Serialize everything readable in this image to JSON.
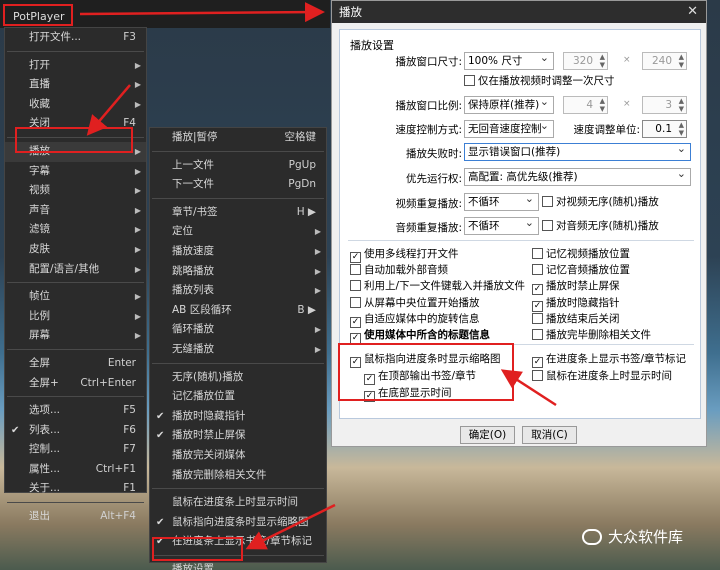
{
  "app": {
    "name": "PotPlayer"
  },
  "main_menu": [
    {
      "label": "打开文件...",
      "shortcut": "F3"
    },
    {
      "label": "打开",
      "arrow": "▶"
    },
    {
      "label": "直播",
      "arrow": "▶"
    },
    {
      "label": "收藏",
      "arrow": "▶"
    },
    {
      "label": "关闭",
      "shortcut": "F4"
    },
    {
      "label": "播放",
      "arrow": "▶"
    },
    {
      "label": "字幕",
      "arrow": "▶"
    },
    {
      "label": "视频",
      "arrow": "▶"
    },
    {
      "label": "声音",
      "arrow": "▶"
    },
    {
      "label": "滤镜",
      "arrow": "▶"
    },
    {
      "label": "皮肤",
      "arrow": "▶"
    },
    {
      "label": "配置/语言/其他",
      "arrow": "▶"
    },
    {
      "label": "帧位",
      "arrow": "▶"
    },
    {
      "label": "比例",
      "arrow": "▶"
    },
    {
      "label": "屏幕",
      "arrow": "▶"
    },
    {
      "label": "全屏",
      "shortcut": "Enter"
    },
    {
      "label": "全屏+",
      "shortcut": "Ctrl+Enter"
    },
    {
      "label": "选项...",
      "shortcut": "F5"
    },
    {
      "label": "列表...",
      "shortcut": "F6",
      "check": "✔"
    },
    {
      "label": "控制...",
      "shortcut": "F7"
    },
    {
      "label": "属性...",
      "shortcut": "Ctrl+F1"
    },
    {
      "label": "关于...",
      "shortcut": "F1"
    },
    {
      "label": "退出",
      "shortcut": "Alt+F4"
    }
  ],
  "play_menu": [
    {
      "label": "播放|暂停",
      "shortcut": "空格键"
    },
    {
      "label": "上一文件",
      "shortcut": "PgUp"
    },
    {
      "label": "下一文件",
      "shortcut": "PgDn"
    },
    {
      "label": "章节/书签",
      "shortcut": "H ▶"
    },
    {
      "label": "定位",
      "arrow": "▶"
    },
    {
      "label": "播放速度",
      "arrow": "▶"
    },
    {
      "label": "跳略播放",
      "arrow": "▶"
    },
    {
      "label": "播放列表",
      "arrow": "▶"
    },
    {
      "label": "AB 区段循环",
      "shortcut": "B ▶"
    },
    {
      "label": "循环播放",
      "arrow": "▶"
    },
    {
      "label": "无缝播放",
      "arrow": "▶"
    },
    {
      "label": "无序(随机)播放"
    },
    {
      "label": "记忆播放位置"
    },
    {
      "label": "播放时隐藏指针",
      "check": "✔"
    },
    {
      "label": "播放时禁止屏保",
      "check": "✔"
    },
    {
      "label": "播放完关闭媒体"
    },
    {
      "label": "播放完删除相关文件"
    },
    {
      "label": "鼠标在进度条上时显示时间"
    },
    {
      "label": "鼠标指向进度条时显示缩略图",
      "check": "✔"
    },
    {
      "label": "在进度条上显示书签/章节标记",
      "check": "✔"
    },
    {
      "label": "播放设置..."
    }
  ],
  "dialog": {
    "title": "播放",
    "close": "✕",
    "group": "播放设置",
    "window_size_label": "播放窗口尺寸:",
    "window_size": "100% 尺寸",
    "width": "320",
    "height": "240",
    "times": "×",
    "only_first_resize": "仅在播放视频时调整一次尺寸",
    "aspect_label": "播放窗口比例:",
    "aspect": "保持原样(推荐)",
    "ratio_w": "4",
    "ratio_h": "3",
    "speed_ctrl_label": "速度控制方式:",
    "speed_ctrl": "无回音速度控制",
    "speed_unit_label": "速度调整单位:",
    "speed_unit": "0.1",
    "fail_label": "播放失败时:",
    "fail": "显示错误窗口(推荐)",
    "priority_label": "优先运行权:",
    "priority": "高配置: 高优先级(推荐)",
    "video_repeat_label": "视频重复播放:",
    "video_repeat": "不循环",
    "video_random": "对视频无序(随机)播放",
    "audio_repeat_label": "音频重复播放:",
    "audio_repeat": "不循环",
    "audio_random": "对音频无序(随机)播放",
    "checks_left": [
      {
        "label": "使用多线程打开文件",
        "checked": true
      },
      {
        "label": "自动加载外部音频",
        "checked": false
      },
      {
        "label": "利用上/下一文件键载入并播放文件",
        "checked": false
      },
      {
        "label": "从屏幕中央位置开始播放",
        "checked": false
      },
      {
        "label": "自适应媒体中的旋转信息",
        "checked": true
      },
      {
        "label": "使用媒体中所含的标题信息",
        "checked": true
      }
    ],
    "checks_right": [
      {
        "label": "记忆视频播放位置",
        "checked": false
      },
      {
        "label": "记忆音频播放位置",
        "checked": false
      },
      {
        "label": "播放时禁止屏保",
        "checked": true
      },
      {
        "label": "播放时隐藏指针",
        "checked": true
      },
      {
        "label": "播放结束后关闭",
        "checked": false
      },
      {
        "label": "播放完毕删除相关文件",
        "checked": false
      }
    ],
    "thumb": "鼠标指向进度条时显示缩略图",
    "top_chapter": "在顶部输出书签/章节",
    "bottom_time": "在底部显示时间",
    "show_marks": "在进度条上显示书签/章节标记",
    "show_time": "鼠标在进度条上时显示时间",
    "ok": "确定(O)",
    "cancel": "取消(C)"
  },
  "watermark": "大众软件库"
}
